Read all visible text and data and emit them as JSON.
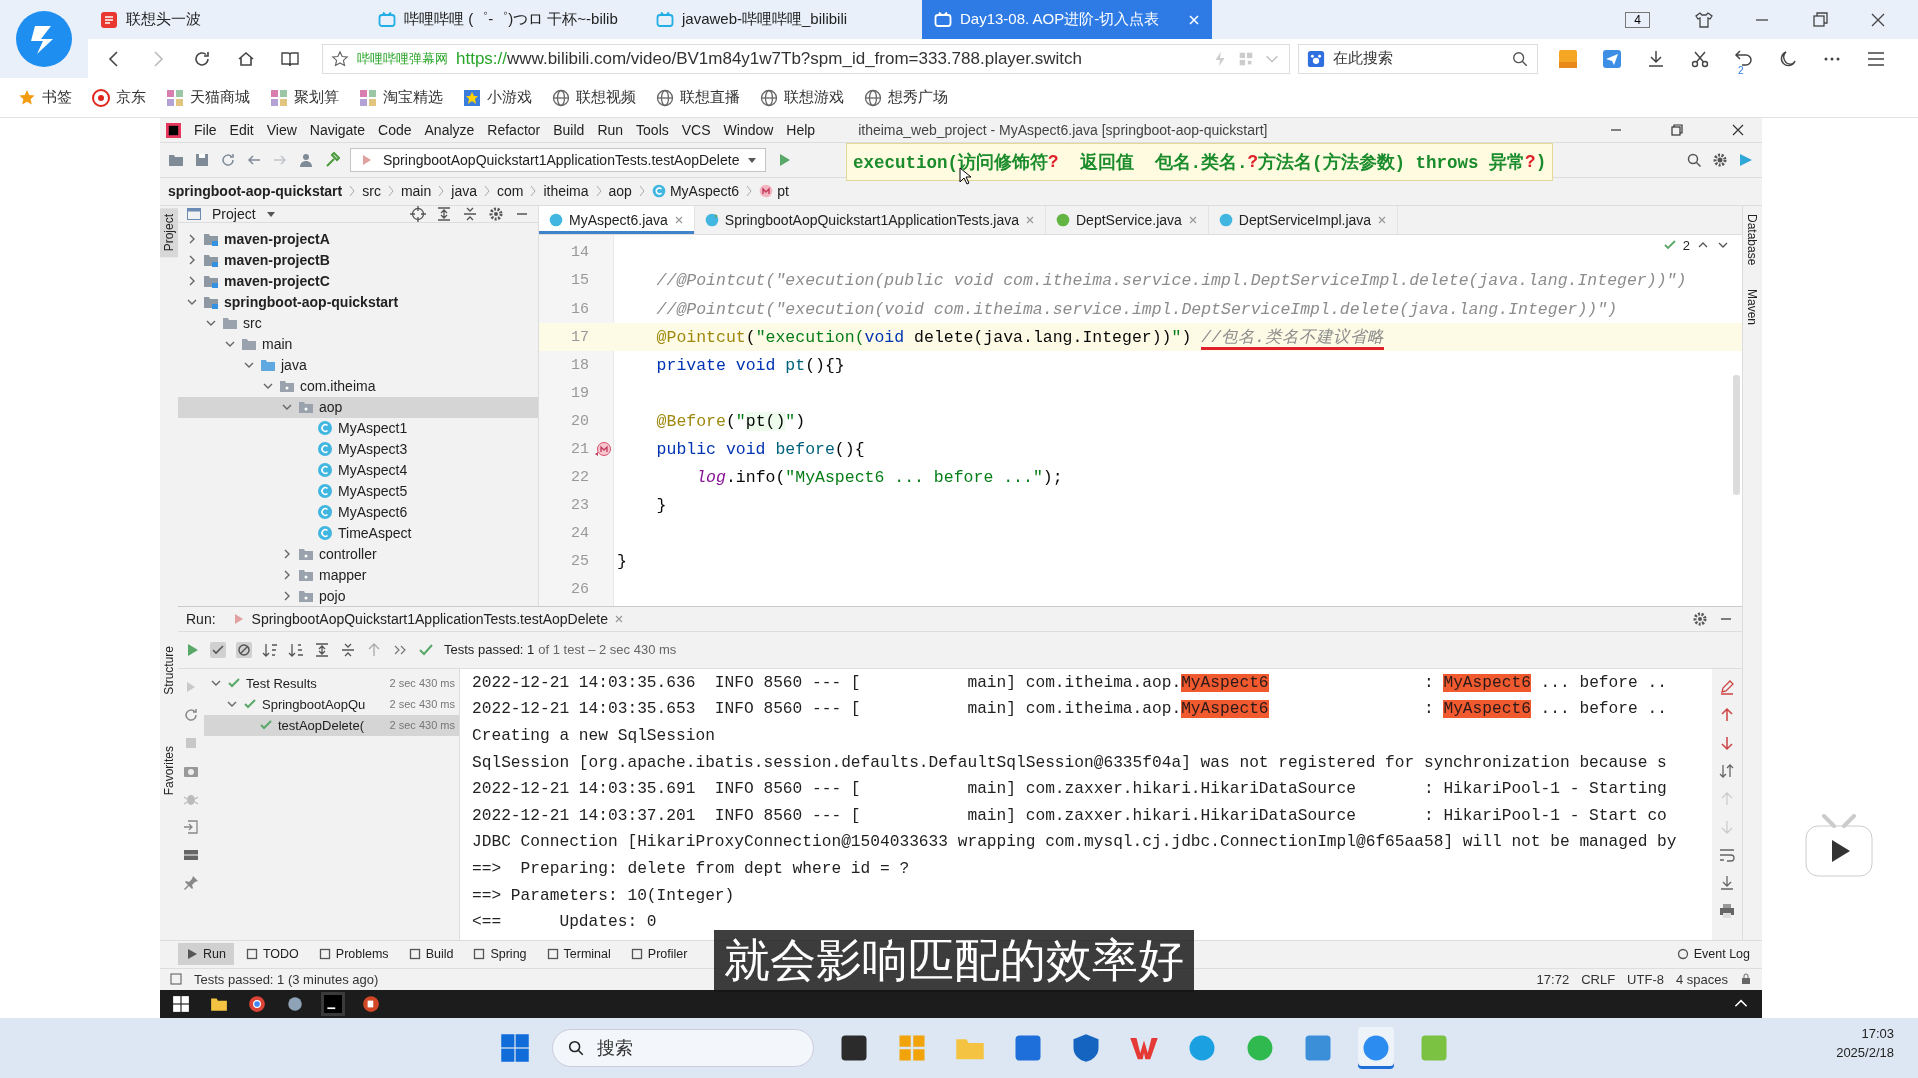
{
  "browser": {
    "tabs": [
      {
        "title": "联想头一波",
        "kind": "portal",
        "selected": false
      },
      {
        "title": "哔哩哔哩 (゜-゜)つロ 干杯~-bilib",
        "kind": "video",
        "selected": false
      },
      {
        "title": "javaweb-哔哩哔哩_bilibili",
        "kind": "video",
        "selected": false
      },
      {
        "title": "Day13-08. AOP进阶-切入点表",
        "kind": "video",
        "selected": true
      }
    ],
    "tab_count": "4",
    "address": {
      "site": "哔哩哔哩弹幕网",
      "scheme": "https://",
      "url": "www.bilibili.com/video/BV1m84y1w7Tb?spm_id_from=333.788.player.switch"
    },
    "search": {
      "placeholder": "在此搜索"
    },
    "history_badge": "2",
    "bookmarks": [
      {
        "label": "书签",
        "kind": "star"
      },
      {
        "label": "京东",
        "kind": "shop"
      },
      {
        "label": "天猫商城",
        "kind": "grid"
      },
      {
        "label": "聚划算",
        "kind": "grid"
      },
      {
        "label": "淘宝精选",
        "kind": "grid"
      },
      {
        "label": "小游戏",
        "kind": "game"
      },
      {
        "label": "联想视频",
        "kind": "globe"
      },
      {
        "label": "联想直播",
        "kind": "globe"
      },
      {
        "label": "联想游戏",
        "kind": "globe"
      },
      {
        "label": "想秀广场",
        "kind": "globe"
      }
    ]
  },
  "ide": {
    "menu": [
      "File",
      "Edit",
      "View",
      "Navigate",
      "Code",
      "Analyze",
      "Refactor",
      "Build",
      "Run",
      "Tools",
      "VCS",
      "Window",
      "Help"
    ],
    "title": "itheima_web_project - MyAspect6.java [springboot-aop-quickstart]",
    "run_config": "SpringbootAopQuickstart1ApplicationTests.testAopDelete",
    "tooltip": [
      {
        "text": "execution(访问修饰符",
        "kind": "text"
      },
      {
        "text": "?",
        "kind": "optional"
      },
      {
        "text": "  返回值  包名.类名.",
        "kind": "text"
      },
      {
        "text": "?",
        "kind": "optional"
      },
      {
        "text": "方法名(方法参数) throws 异常",
        "kind": "text"
      },
      {
        "text": "?",
        "kind": "optional"
      },
      {
        "text": ")",
        "kind": "text"
      }
    ],
    "breadcrumbs": [
      {
        "label": "springboot-aop-quickstart",
        "kind": "project"
      },
      {
        "label": "src",
        "kind": "plain"
      },
      {
        "label": "main",
        "kind": "plain"
      },
      {
        "label": "java",
        "kind": "plain"
      },
      {
        "label": "com",
        "kind": "plain"
      },
      {
        "label": "itheima",
        "kind": "plain"
      },
      {
        "label": "aop",
        "kind": "plain"
      },
      {
        "label": "MyAspect6",
        "kind": "class"
      },
      {
        "label": "pt",
        "kind": "method"
      }
    ],
    "side_labels_left": [
      {
        "label": "Project",
        "selected": true
      },
      {
        "label": "Structure",
        "selected": false
      },
      {
        "label": "Favorites",
        "selected": false
      }
    ],
    "side_labels_right": [
      "Database",
      "Maven"
    ],
    "project_panel": {
      "title": "Project",
      "tree": [
        {
          "label": "maven-projectA",
          "kind": "module",
          "expanded": false,
          "selected": false
        },
        {
          "label": "maven-projectB",
          "kind": "module",
          "expanded": false,
          "selected": false
        },
        {
          "label": "maven-projectC",
          "kind": "module",
          "expanded": false,
          "selected": false
        },
        {
          "label": "springboot-aop-quickstart",
          "kind": "module",
          "expanded": true,
          "selected": false,
          "children": [
            {
              "label": "src",
              "kind": "folder",
              "expanded": true,
              "selected": false,
              "children": [
                {
                  "label": "main",
                  "kind": "folder",
                  "expanded": true,
                  "selected": false,
                  "children": [
                    {
                      "label": "java",
                      "kind": "source",
                      "expanded": true,
                      "selected": false,
                      "children": [
                        {
                          "label": "com.itheima",
                          "kind": "package",
                          "expanded": true,
                          "selected": false,
                          "children": [
                            {
                              "label": "aop",
                              "kind": "package",
                              "expanded": true,
                              "selected": true,
                              "children": [
                                {
                                  "label": "MyAspect1",
                                  "kind": "class",
                                  "selected": false
                                },
                                {
                                  "label": "MyAspect3",
                                  "kind": "class",
                                  "selected": false
                                },
                                {
                                  "label": "MyAspect4",
                                  "kind": "class",
                                  "selected": false
                                },
                                {
                                  "label": "MyAspect5",
                                  "kind": "class",
                                  "selected": false
                                },
                                {
                                  "label": "MyAspect6",
                                  "kind": "class",
                                  "selected": false
                                },
                                {
                                  "label": "TimeAspect",
                                  "kind": "class",
                                  "selected": false
                                }
                              ]
                            },
                            {
                              "label": "controller",
                              "kind": "package",
                              "expanded": false,
                              "selected": false
                            },
                            {
                              "label": "mapper",
                              "kind": "package",
                              "expanded": false,
                              "selected": false
                            },
                            {
                              "label": "pojo",
                              "kind": "package",
                              "expanded": false,
                              "selected": false
                            }
                          ]
                        }
                      ]
                    }
                  ]
                }
              ]
            }
          ]
        }
      ]
    },
    "editor_tabs": [
      {
        "label": "MyAspect6.java",
        "kind": "class",
        "selected": true
      },
      {
        "label": "SpringbootAopQuickstart1ApplicationTests.java",
        "kind": "test",
        "selected": false
      },
      {
        "label": "DeptService.java",
        "kind": "interface",
        "selected": false
      },
      {
        "label": "DeptServiceImpl.java",
        "kind": "class",
        "selected": false
      }
    ],
    "inspection_count": "2",
    "code_lines": [
      {
        "number": "14",
        "current": false,
        "marker": false
      },
      {
        "number": "15",
        "current": false,
        "marker": false,
        "segments": [
          {
            "kind": "comment",
            "text": "    //@Pointcut(\"execution(public void com.itheima.service.impl.DeptServiceImpl.delete(java.lang.Integer))\")"
          }
        ]
      },
      {
        "number": "16",
        "current": false,
        "marker": false,
        "segments": [
          {
            "kind": "comment",
            "text": "    //@Pointcut(\"execution(void com.itheima.service.impl.DeptServiceImpl.delete(java.lang.Integer))\")"
          }
        ]
      },
      {
        "number": "17",
        "current": true,
        "marker": false,
        "segments": [
          {
            "kind": "annotation",
            "text": "    @Pointcut"
          },
          {
            "kind": "plain",
            "text": "("
          },
          {
            "kind": "string",
            "text": "\"execution("
          },
          {
            "kind": "keyword",
            "text": "void"
          },
          {
            "kind": "plain",
            "text": " delete(java.lang.Integer))"
          },
          {
            "kind": "string",
            "text": "\""
          },
          {
            "kind": "plain",
            "text": ") "
          },
          {
            "kind": "comment-underlined",
            "text": "//包名.类名不建议省略"
          }
        ]
      },
      {
        "number": "18",
        "current": false,
        "marker": false,
        "segments": [
          {
            "kind": "keyword",
            "text": "    private void"
          },
          {
            "kind": "method",
            "text": " pt"
          },
          {
            "kind": "plain",
            "text": "(){}"
          }
        ]
      },
      {
        "number": "19",
        "current": false,
        "marker": false
      },
      {
        "number": "20",
        "current": false,
        "marker": false,
        "segments": [
          {
            "kind": "annotation",
            "text": "    @Before"
          },
          {
            "kind": "plain",
            "text": "("
          },
          {
            "kind": "string",
            "text": "\""
          },
          {
            "kind": "reference",
            "text": "pt()"
          },
          {
            "kind": "string",
            "text": "\""
          },
          {
            "kind": "plain",
            "text": ")"
          }
        ]
      },
      {
        "number": "21",
        "current": false,
        "marker": true,
        "segments": [
          {
            "kind": "keyword",
            "text": "    public void"
          },
          {
            "kind": "method",
            "text": " before"
          },
          {
            "kind": "plain",
            "text": "(){"
          }
        ]
      },
      {
        "number": "22",
        "current": false,
        "marker": false,
        "segments": [
          {
            "kind": "field",
            "text": "        log"
          },
          {
            "kind": "plain",
            "text": ".info("
          },
          {
            "kind": "string",
            "text": "\"MyAspect6 ... before ...\""
          },
          {
            "kind": "plain",
            "text": ");"
          }
        ]
      },
      {
        "number": "23",
        "current": false,
        "marker": false,
        "segments": [
          {
            "kind": "plain",
            "text": "    }"
          }
        ]
      },
      {
        "number": "24",
        "current": false,
        "marker": false
      },
      {
        "number": "25",
        "current": false,
        "marker": false,
        "segments": [
          {
            "kind": "plain",
            "text": "}"
          }
        ]
      },
      {
        "number": "26",
        "current": false,
        "marker": false
      }
    ],
    "run_panel": {
      "label": "Run:",
      "tab": "SpringbootAopQuickstart1ApplicationTests.testAopDelete",
      "status": "Tests passed: 1",
      "status_detail": "of 1 test – 2 sec 430 ms",
      "test_tree": [
        {
          "label": "Test Results",
          "time": "2 sec 430 ms",
          "expanded": true,
          "selected": false,
          "children": [
            {
              "label": "SpringbootAopQu",
              "time": "2 sec 430 ms",
              "expanded": true,
              "selected": false,
              "children": [
                {
                  "label": "testAopDelete(",
                  "time": "2 sec 430 ms",
                  "selected": true
                }
              ]
            }
          ]
        }
      ],
      "console": [
        {
          "segments": [
            {
              "kind": "text",
              "text": "2022-12-21 14:03:35.636  INFO 8560 --- [           main] com.itheima.aop."
            },
            {
              "kind": "match",
              "text": "MyAspect6"
            },
            {
              "kind": "text",
              "text": "                : "
            },
            {
              "kind": "match",
              "text": "MyAspect6"
            },
            {
              "kind": "text",
              "text": " ... before .."
            }
          ]
        },
        {
          "segments": [
            {
              "kind": "text",
              "text": "2022-12-21 14:03:35.653  INFO 8560 --- [           main] com.itheima.aop."
            },
            {
              "kind": "match",
              "text": "MyAspect6"
            },
            {
              "kind": "text",
              "text": "                : "
            },
            {
              "kind": "match",
              "text": "MyAspect6"
            },
            {
              "kind": "text",
              "text": " ... before .."
            }
          ]
        },
        {
          "segments": [
            {
              "kind": "text",
              "text": "Creating a new SqlSession"
            }
          ]
        },
        {
          "segments": [
            {
              "kind": "text",
              "text": "SqlSession [org.apache.ibatis.session.defaults.DefaultSqlSession@6335f04a] was not registered for synchronization because s"
            }
          ]
        },
        {
          "segments": [
            {
              "kind": "text",
              "text": "2022-12-21 14:03:35.691  INFO 8560 --- [           main] com.zaxxer.hikari.HikariDataSource       : HikariPool-1 - Starting"
            }
          ]
        },
        {
          "segments": [
            {
              "kind": "text",
              "text": "2022-12-21 14:03:37.201  INFO 8560 --- [           main] com.zaxxer.hikari.HikariDataSource       : HikariPool-1 - Start co"
            }
          ]
        },
        {
          "segments": [
            {
              "kind": "text",
              "text": "JDBC Connection [HikariProxyConnection@1504033633 wrapping com.mysql.cj.jdbc.ConnectionImpl@6f65aa58] will not be managed by"
            }
          ]
        },
        {
          "segments": [
            {
              "kind": "text",
              "text": "==>  Preparing: delete from dept where id = ?"
            }
          ]
        },
        {
          "segments": [
            {
              "kind": "text",
              "text": "==> Parameters: 10(Integer)"
            }
          ]
        },
        {
          "segments": [
            {
              "kind": "text",
              "text": "<==      Updates: 0"
            }
          ]
        }
      ]
    },
    "tool_tabs": [
      {
        "label": "Run",
        "selected": true
      },
      {
        "label": "TODO",
        "selected": false
      },
      {
        "label": "Problems",
        "selected": false
      },
      {
        "label": "Build",
        "selected": false
      },
      {
        "label": "Spring",
        "selected": false
      },
      {
        "label": "Terminal",
        "selected": false
      },
      {
        "label": "Profiler",
        "selected": false
      }
    ],
    "event_log": "Event Log",
    "status_bar": {
      "message": "Tests passed: 1 (3 minutes ago)",
      "position": "17:72",
      "line_separator": "CRLF",
      "encoding": "UTF-8",
      "indent": "4 spaces"
    }
  },
  "subtitle": "就会影响匹配的效率好",
  "taskbar": {
    "search": {
      "placeholder": "搜索"
    },
    "time": "17:03",
    "date": "2025/2/18"
  }
}
